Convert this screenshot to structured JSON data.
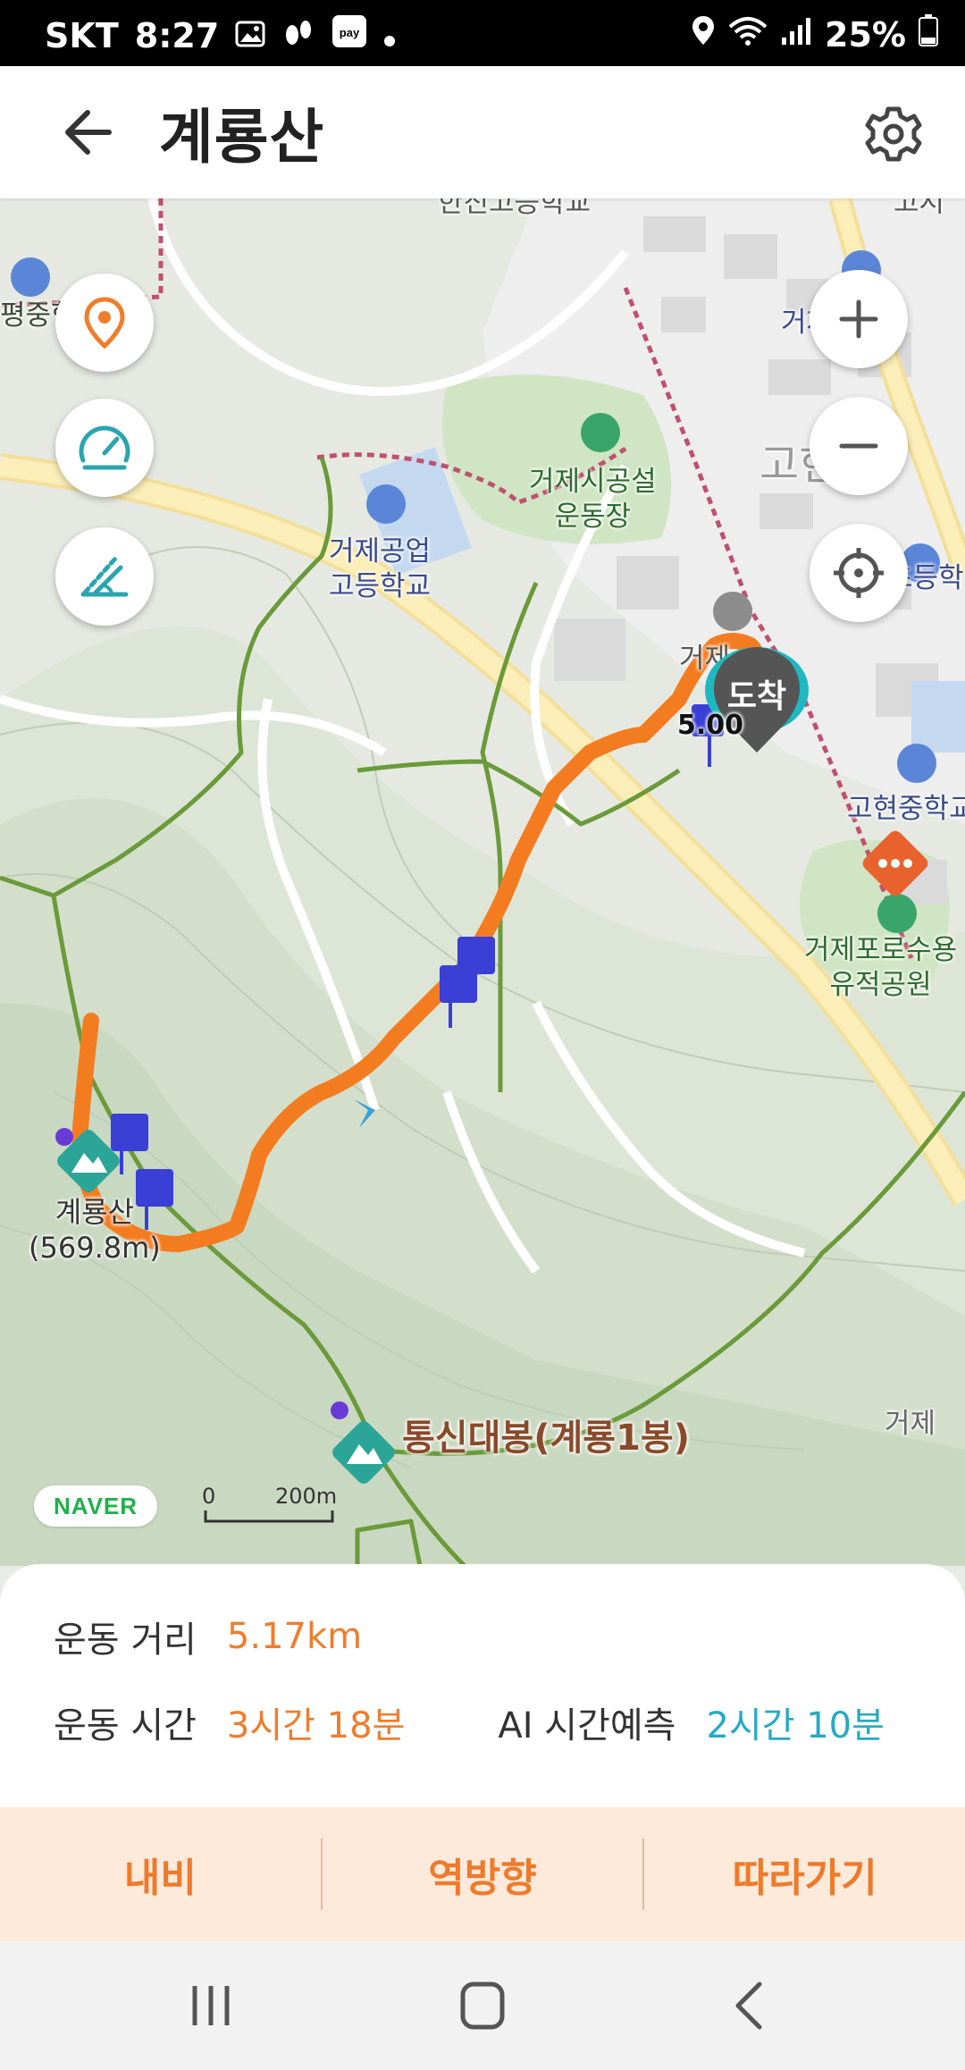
{
  "status_bar": {
    "carrier": "SKT",
    "time": "8:27",
    "battery": "25%",
    "icons": [
      "gallery-icon",
      "footprint-icon",
      "pay-icon",
      "dot-icon",
      "location-icon",
      "wifi-icon",
      "signal-icon",
      "battery-icon"
    ]
  },
  "app_bar": {
    "title": "계룡산",
    "back_icon": "arrow-left-icon",
    "settings_icon": "gear-icon"
  },
  "map": {
    "left_controls": [
      "location-pin-icon",
      "speedometer-icon",
      "slope-icon"
    ],
    "right_controls": [
      "zoom-in-icon",
      "zoom-out-icon",
      "locate-icon"
    ],
    "labels": {
      "school_left": "평중학",
      "sports_field": "거제시공설\n운동장",
      "tech_school": "거제공업\n고등학교",
      "top_right": "거제시장",
      "right_mid": "거제초등학",
      "gohyeon_school": "고현중학교",
      "ruins_park": "거제포로수용\n유적공원",
      "geoje_center": "거제",
      "geoje_right": "거제",
      "gohyeon": "고현",
      "top_school": "한진고등학교",
      "top_right_corner": "고시"
    },
    "peaks": {
      "main_peak": "계룡산\n(569.8m)",
      "secondary_peak": "통신대봉(계룡1봉)"
    },
    "arrival_label": "도착",
    "distance_marker": "5.00",
    "naver_logo": "NAVER",
    "scale_zero": "0",
    "scale_value": "200m",
    "colors": {
      "route": "#f47c20",
      "trail": "#6a9a3a",
      "marker": "#3a3fd6"
    }
  },
  "info": {
    "distance_label": "운동 거리",
    "distance_value": "5.17km",
    "time_label": "운동 시간",
    "time_value": "3시간 18분",
    "ai_label": "AI 시간예측",
    "ai_value": "2시간 10분"
  },
  "actions": {
    "navi": "내비",
    "reverse": "역방향",
    "follow": "따라가기"
  },
  "nav_bar": {
    "icons": [
      "recent-apps-icon",
      "home-icon",
      "back-icon"
    ]
  }
}
